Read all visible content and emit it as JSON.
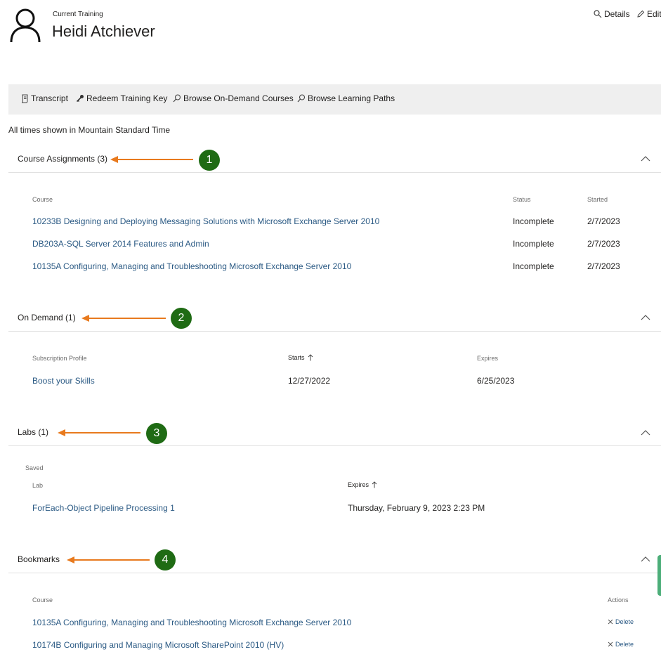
{
  "header": {
    "overline": "Current Training",
    "user_name": "Heidi Atchiever",
    "details_label": "Details",
    "edit_label": "Edit"
  },
  "toolbar": {
    "transcript": "Transcript",
    "redeem": "Redeem Training Key",
    "browse_courses": "Browse On-Demand Courses",
    "browse_paths": "Browse Learning Paths"
  },
  "timezone_note": "All times shown in Mountain Standard Time",
  "course_assignments": {
    "title": "Course Assignments (3)",
    "badge": "1",
    "columns": {
      "course": "Course",
      "status": "Status",
      "started": "Started"
    },
    "rows": [
      {
        "course": "10233B Designing and Deploying Messaging Solutions with Microsoft Exchange Server 2010",
        "status": "Incomplete",
        "started": "2/7/2023"
      },
      {
        "course": "DB203A-SQL Server 2014 Features and Admin",
        "status": "Incomplete",
        "started": "2/7/2023"
      },
      {
        "course": "10135A Configuring, Managing and Troubleshooting Microsoft Exchange Server 2010",
        "status": "Incomplete",
        "started": "2/7/2023"
      }
    ]
  },
  "on_demand": {
    "title": "On Demand (1)",
    "badge": "2",
    "columns": {
      "profile": "Subscription Profile",
      "starts": "Starts",
      "expires": "Expires"
    },
    "rows": [
      {
        "profile": "Boost your Skills",
        "starts": "12/27/2022",
        "expires": "6/25/2023"
      }
    ]
  },
  "labs": {
    "title": "Labs (1)",
    "badge": "3",
    "group_label": "Saved",
    "columns": {
      "lab": "Lab",
      "expires": "Expires"
    },
    "rows": [
      {
        "lab": "ForEach-Object Pipeline Processing 1",
        "expires": "Thursday, February 9, 2023 2:23 PM"
      }
    ]
  },
  "bookmarks": {
    "title": "Bookmarks",
    "badge": "4",
    "columns": {
      "course": "Course",
      "actions": "Actions"
    },
    "rows": [
      {
        "course": "10135A Configuring, Managing and Troubleshooting Microsoft Exchange Server 2010",
        "action": "Delete"
      },
      {
        "course": "10174B Configuring and Managing Microsoft SharePoint 2010 (HV)",
        "action": "Delete"
      }
    ]
  },
  "colors": {
    "link": "#2b5a84",
    "badge": "#1f6b14",
    "arrow": "#e87a1e",
    "toolbar_bg": "#efefef"
  },
  "icons": [
    "user-avatar-icon",
    "search-icon",
    "pencil-icon",
    "transcript-icon",
    "key-icon",
    "sort-up-arrow-icon",
    "chevron-up-icon",
    "close-icon"
  ]
}
